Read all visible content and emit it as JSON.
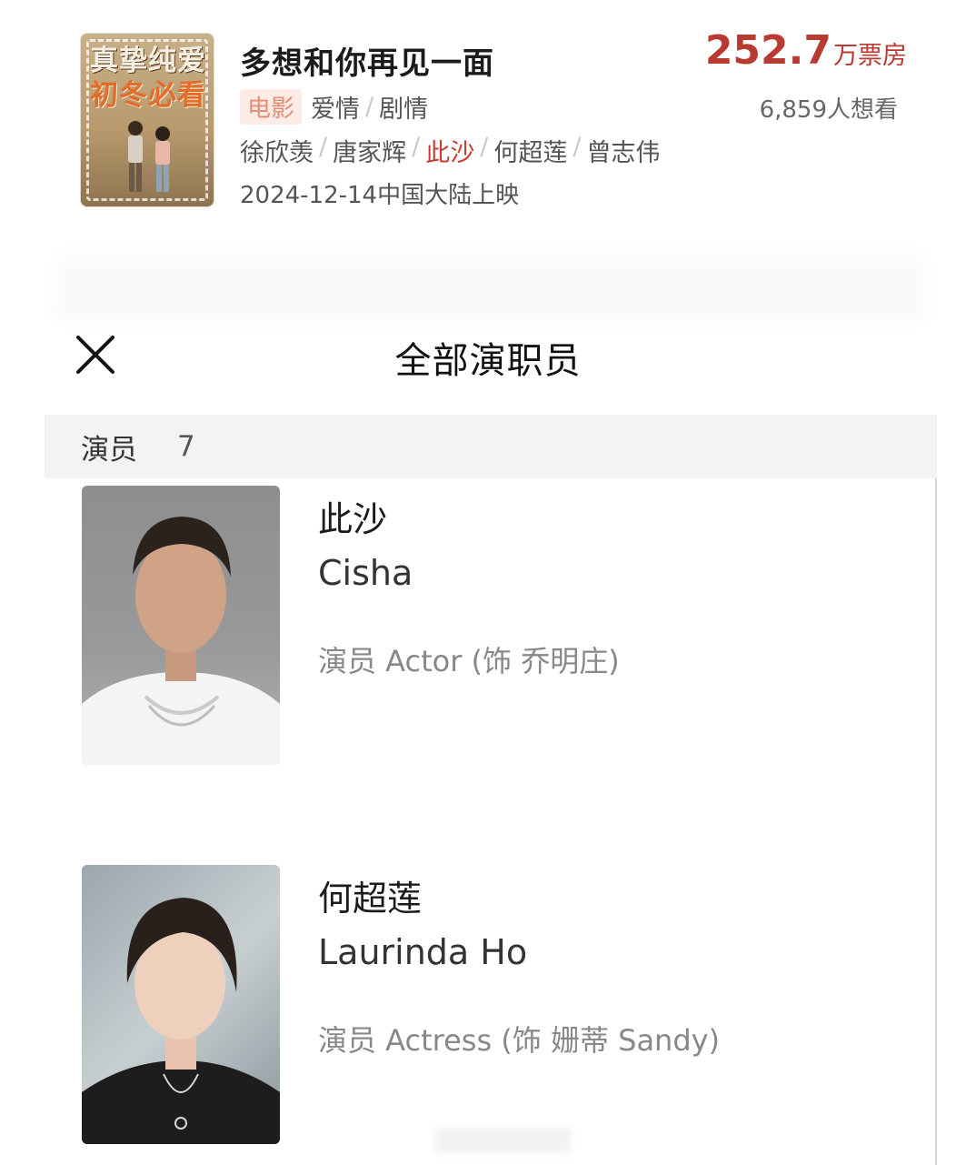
{
  "movie": {
    "title": "多想和你再见一面",
    "poster_text_line1": "真挚纯爱",
    "poster_text_line2": "初冬必看",
    "type_tag": "电影",
    "genres": [
      "爱情",
      "剧情"
    ],
    "genre_separator": "/",
    "cast": [
      "徐欣羡",
      "唐家辉",
      "此沙",
      "何超莲",
      "曾志伟"
    ],
    "highlighted_cast_index": 2,
    "release": "2024-12-14中国大陆上映",
    "box_office_value": "252.7",
    "box_office_unit": "万票房",
    "want_to_see": "6,859人想看"
  },
  "sheet": {
    "title": "全部演职员",
    "close_icon": "close-icon",
    "section_label": "演员",
    "section_count": "7"
  },
  "cast_list": [
    {
      "name_cn": "此沙",
      "name_en": "Cisha",
      "role": "演员 Actor (饰 乔明庄)"
    },
    {
      "name_cn": "何超莲",
      "name_en": "Laurinda Ho",
      "role": "演员 Actress (饰 姗蒂 Sandy)"
    }
  ],
  "colors": {
    "accent_red": "#b83a31",
    "tag_bg": "#fdebe6",
    "tag_text": "#e58b73",
    "section_bg": "#f3f3f3"
  }
}
